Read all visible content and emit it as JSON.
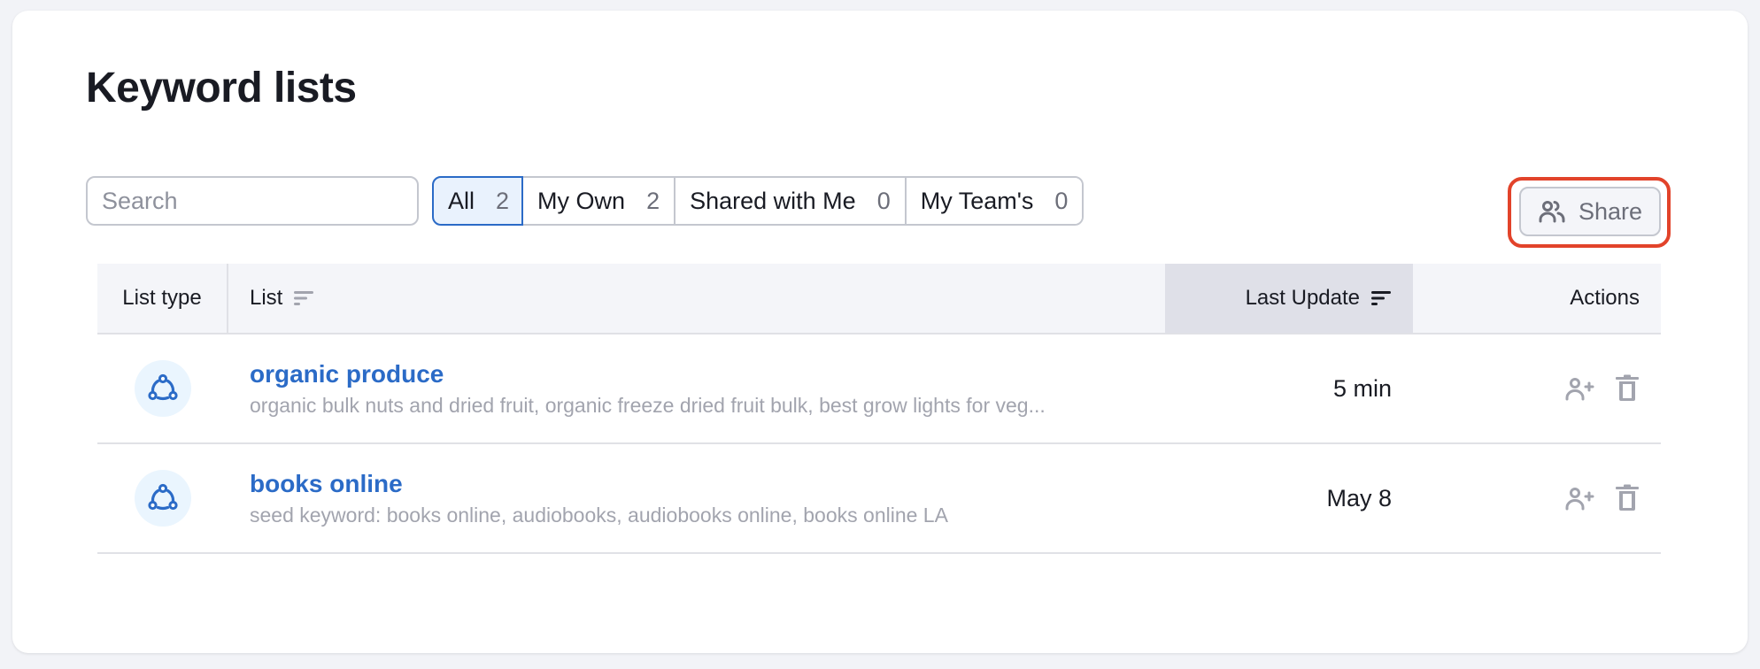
{
  "page": {
    "title": "Keyword lists"
  },
  "search": {
    "placeholder": "Search",
    "value": "",
    "button_icon": "search-icon"
  },
  "filter_tabs": [
    {
      "label": "All",
      "count": "2",
      "active": true
    },
    {
      "label": "My Own",
      "count": "2",
      "active": false
    },
    {
      "label": "Shared with Me",
      "count": "0",
      "active": false
    },
    {
      "label": "My Team's",
      "count": "0",
      "active": false
    }
  ],
  "share_button": {
    "label": "Share",
    "icon": "users-icon",
    "highlighted": true,
    "highlight_color": "#e2432a"
  },
  "table": {
    "columns": {
      "list_type": "List type",
      "list": "List",
      "last_update": "Last Update",
      "actions": "Actions"
    },
    "sorted_column": "last_update",
    "rows": [
      {
        "type_icon": "share-network-icon",
        "name": "organic produce",
        "description": "organic bulk nuts and dried fruit, organic freeze dried fruit bulk, best grow lights for veg...",
        "last_update": "5 min",
        "actions": [
          "add-user-icon",
          "trash-icon"
        ]
      },
      {
        "type_icon": "share-network-icon",
        "name": "books online",
        "description": "seed keyword: books online, audiobooks, audiobooks online, books online LA",
        "last_update": "May 8",
        "actions": [
          "add-user-icon",
          "trash-icon"
        ]
      }
    ]
  },
  "colors": {
    "accent": "#2b6bc7",
    "active_tab_bg": "#e9f2fd",
    "muted_text": "#a2a4ae",
    "highlight": "#e2432a"
  }
}
